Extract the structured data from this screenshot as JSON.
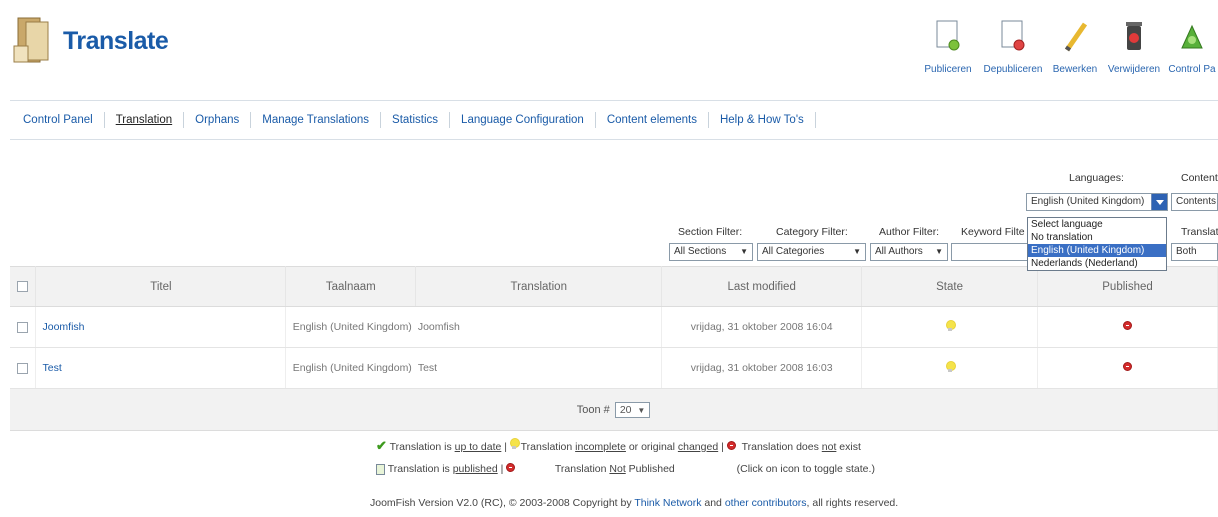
{
  "header": {
    "title": "Translate",
    "toolbar": [
      {
        "label": "Publiceren",
        "icon": "publish-icon"
      },
      {
        "label": "Depubliceren",
        "icon": "unpublish-icon"
      },
      {
        "label": "Bewerken",
        "icon": "edit-icon"
      },
      {
        "label": "Verwijderen",
        "icon": "trash-icon"
      },
      {
        "label": "Control Pa",
        "icon": "control-panel-icon"
      }
    ]
  },
  "submenu": [
    {
      "label": "Control Panel",
      "active": false
    },
    {
      "label": "Translation",
      "active": true
    },
    {
      "label": "Orphans",
      "active": false
    },
    {
      "label": "Manage Translations",
      "active": false
    },
    {
      "label": "Statistics",
      "active": false
    },
    {
      "label": "Language Configuration",
      "active": false
    },
    {
      "label": "Content elements",
      "active": false
    },
    {
      "label": "Help & How To's",
      "active": false
    }
  ],
  "filters": {
    "section_label": "Section Filter:",
    "section_value": "All Sections",
    "category_label": "Category Filter:",
    "category_value": "All Categories",
    "author_label": "Author Filter:",
    "author_value": "All Authors",
    "keyword_label": "Keyword Filte",
    "languages_label": "Languages:",
    "languages_value": "English (United Kingdom)",
    "content_label": "Content",
    "content_value": "Contents",
    "translate_label": "Translat",
    "translate_value": "Both",
    "language_options": [
      {
        "label": "Select language",
        "selected": false
      },
      {
        "label": "No translation",
        "selected": false
      },
      {
        "label": "English (United Kingdom)",
        "selected": true
      },
      {
        "label": "Nederlands (Nederland)",
        "selected": false
      }
    ]
  },
  "table": {
    "headers": {
      "titel": "Titel",
      "taalnaam": "Taalnaam",
      "translation": "Translation",
      "last_modified": "Last modified",
      "state": "State",
      "published": "Published"
    },
    "rows": [
      {
        "titel": "Joomfish",
        "taalnaam": "English (United Kingdom)",
        "translation": "Joomfish",
        "last_modified": "vrijdag, 31 oktober 2008 16:04"
      },
      {
        "titel": "Test",
        "taalnaam": "English (United Kingdom)",
        "translation": "Test",
        "last_modified": "vrijdag, 31 oktober 2008 16:03"
      }
    ],
    "pager_label": "Toon #",
    "pager_value": "20"
  },
  "legend": {
    "l1_a": "Translation is",
    "l1_b": "up to date",
    "l1_c": "Translation",
    "l1_d": "incomplete",
    "l1_e": "or original",
    "l1_f": "changed",
    "l1_g": "Translation does",
    "l1_h": "not",
    "l1_i": "exist",
    "l2_a": "Translation is",
    "l2_b": "published",
    "l2_c": "Translation",
    "l2_d": "Not",
    "l2_e": "Published",
    "l2_f": "(Click on icon to toggle state.)",
    "sep": "|"
  },
  "footer": {
    "a": "JoomFish Version V2.0 (RC), © 2003-2008 Copyright by",
    "b": "Think Network",
    "c": "and",
    "d": "other contributors",
    "e": ", all rights reserved."
  }
}
